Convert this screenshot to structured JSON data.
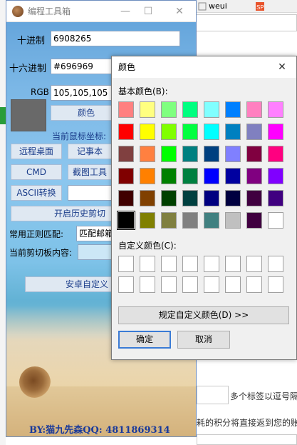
{
  "browser": {
    "tabs": [
      {
        "label": "weui"
      },
      {
        "label": ""
      }
    ],
    "background_texts": {
      "tag_hint": "多个标签以逗号隔",
      "points_hint": "耗的积分将直接返到您的账"
    }
  },
  "tool_window": {
    "title": "编程工具箱",
    "controls": {
      "minimize": "—",
      "maximize": "☐",
      "close": "✕"
    },
    "decimal_label": "十进制",
    "decimal_value": "6908265",
    "hex_label": "十六进制",
    "hex_value": "#696969",
    "rgb_label": "RGB",
    "rgb_value": "105,105,105",
    "preview_color": "#696969",
    "color_button": "颜色",
    "mouse_coord_label": "当前鼠标坐标:",
    "buttons": {
      "remote_desktop": "远程桌面",
      "notepad": "记事本",
      "cmd": "CMD",
      "screenshot": "截图工具",
      "ascii": "ASCII转换",
      "history_clipboard": "开启历史剪切",
      "android_custom": "安卓自定义"
    },
    "ascii_value": "",
    "regex_label": "常用正则匹配:",
    "regex_value": "匹配邮箱",
    "clipboard_label": "当前剪切板内容:",
    "clipboard_value": "",
    "footer": "BY:猫九先森QQ: 4811869314"
  },
  "color_dialog": {
    "title": "颜色",
    "close": "✕",
    "basic_colors_label": "基本颜色(B):",
    "custom_colors_label": "自定义颜色(C):",
    "define_custom_button": "规定自定义颜色(D) >>",
    "ok_button": "确定",
    "cancel_button": "取消",
    "selected_index": 40,
    "basic_colors": [
      "#ff8080",
      "#ffff80",
      "#80ff80",
      "#00ff80",
      "#80ffff",
      "#0080ff",
      "#ff80c0",
      "#ff80ff",
      "#ff0000",
      "#ffff00",
      "#80ff00",
      "#00ff40",
      "#00ffff",
      "#0080c0",
      "#8080c0",
      "#ff00ff",
      "#804040",
      "#ff8040",
      "#00ff00",
      "#008080",
      "#004080",
      "#8080ff",
      "#800040",
      "#ff0080",
      "#800000",
      "#ff8000",
      "#008000",
      "#008040",
      "#0000ff",
      "#0000a0",
      "#800080",
      "#8000ff",
      "#400000",
      "#804000",
      "#004000",
      "#004040",
      "#000080",
      "#000040",
      "#400040",
      "#400080",
      "#000000",
      "#808000",
      "#808040",
      "#808080",
      "#408080",
      "#c0c0c0",
      "#400040",
      "#ffffff"
    ],
    "custom_colors": [
      "#ffffff",
      "#ffffff",
      "#ffffff",
      "#ffffff",
      "#ffffff",
      "#ffffff",
      "#ffffff",
      "#ffffff",
      "#ffffff",
      "#ffffff",
      "#ffffff",
      "#ffffff",
      "#ffffff",
      "#ffffff",
      "#ffffff",
      "#ffffff"
    ]
  }
}
